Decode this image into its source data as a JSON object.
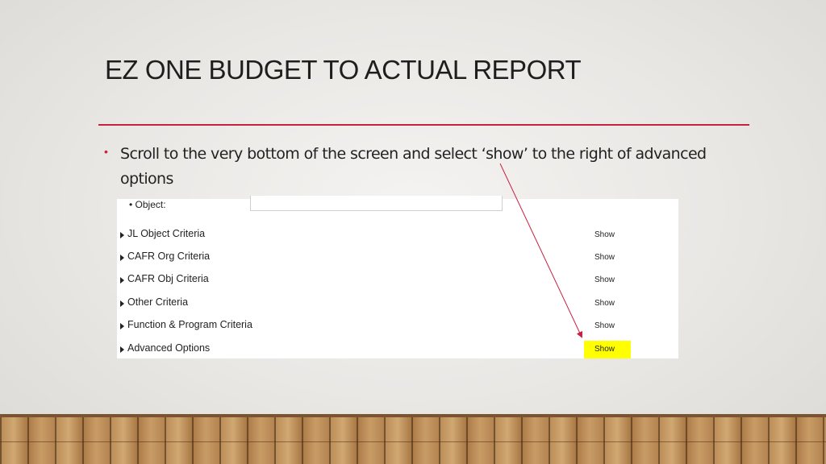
{
  "slide": {
    "title": "EZ ONE BUDGET TO ACTUAL REPORT",
    "bullet": "Scroll to the very bottom of the screen and select ‘show’ to the right of advanced options",
    "accent_color": "#c8203f",
    "highlight_color": "#ffff00"
  },
  "screenshot": {
    "object_label": "• Object:",
    "object_value": "",
    "rows": [
      {
        "label": "JL Object Criteria",
        "action": "Show"
      },
      {
        "label": "CAFR Org Criteria",
        "action": "Show"
      },
      {
        "label": "CAFR Obj Criteria",
        "action": "Show"
      },
      {
        "label": "Other Criteria",
        "action": "Show"
      },
      {
        "label": "Function & Program Criteria",
        "action": "Show"
      },
      {
        "label": "Advanced Options",
        "action": "Show"
      }
    ]
  }
}
